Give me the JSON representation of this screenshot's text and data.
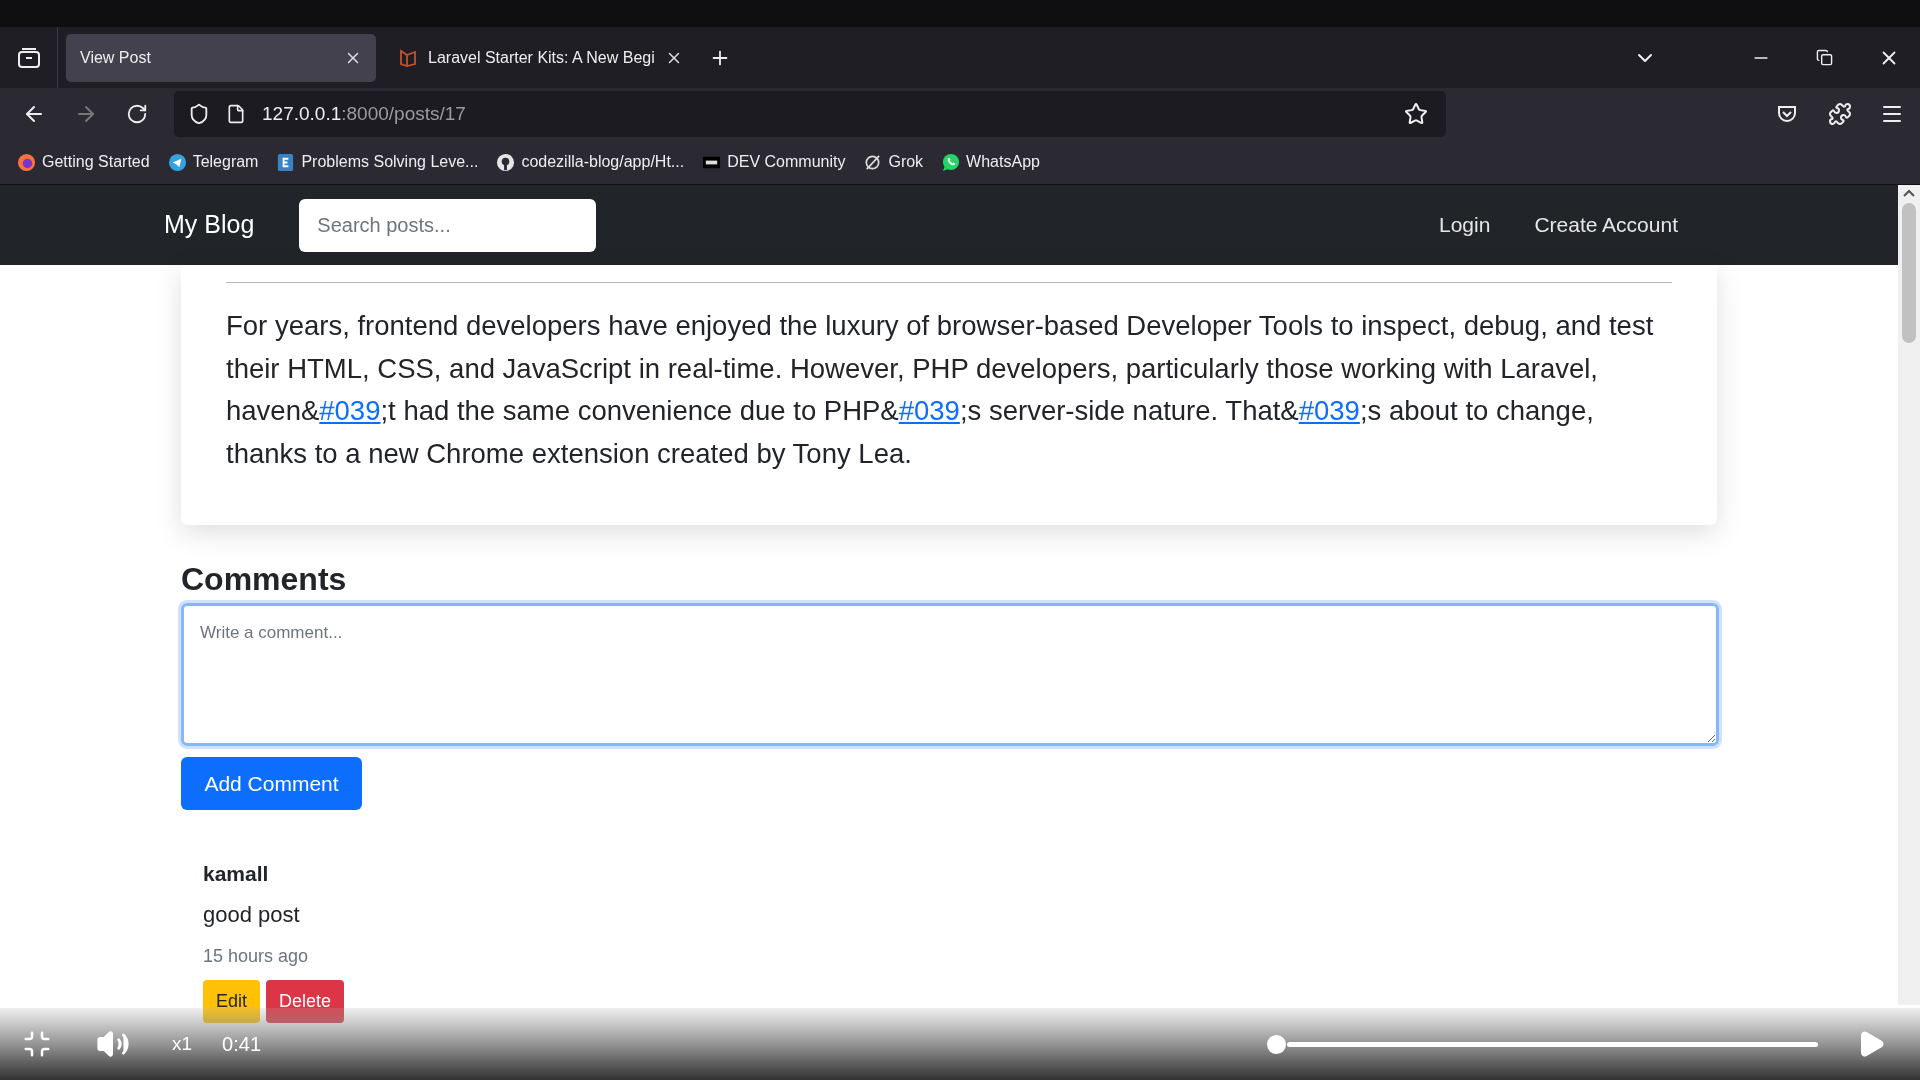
{
  "browser": {
    "tabs": [
      {
        "title": "View Post",
        "selected": true
      },
      {
        "title": "Laravel Starter Kits: A New Begi",
        "selected": false
      }
    ],
    "address": {
      "host": "127.0.0.1",
      "path": ":8000/posts/17"
    },
    "bookmarks": [
      "Getting Started",
      "Telegram",
      "Problems Solving Leve...",
      "codezilla-blog/app/Ht...",
      "DEV Community",
      "Grok",
      "WhatsApp"
    ]
  },
  "navbar": {
    "brand": "My Blog",
    "search": {
      "placeholder": "Search posts..."
    },
    "links": [
      "Login",
      "Create Account"
    ]
  },
  "post": {
    "paragraph": [
      {
        "kind": "text",
        "text": "For years, frontend developers have enjoyed the luxury of browser-based Developer Tools to inspect, debug, and test their HTML, CSS, and JavaScript in real-time. However, PHP developers, particularly those working with Laravel, haven&"
      },
      {
        "kind": "link",
        "text": "#039"
      },
      {
        "kind": "text",
        "text": ";t had the same convenience due to PHP&"
      },
      {
        "kind": "link",
        "text": "#039"
      },
      {
        "kind": "text",
        "text": ";s server-side nature. That&"
      },
      {
        "kind": "link",
        "text": "#039"
      },
      {
        "kind": "text",
        "text": ";s about to change, thanks to a new Chrome extension created by Tony Lea."
      }
    ]
  },
  "comments": {
    "heading": "Comments",
    "input": {
      "placeholder": "Write a comment..."
    },
    "submit": "Add Comment",
    "items": [
      {
        "author": "kamall",
        "body": "good post",
        "time": "15 hours ago",
        "actions": [
          {
            "kind": "edit",
            "label": "Edit"
          },
          {
            "kind": "delete",
            "label": "Delete"
          }
        ]
      }
    ]
  },
  "player": {
    "speed": "x1",
    "time": "0:41",
    "progress": {
      "level": 0
    }
  }
}
